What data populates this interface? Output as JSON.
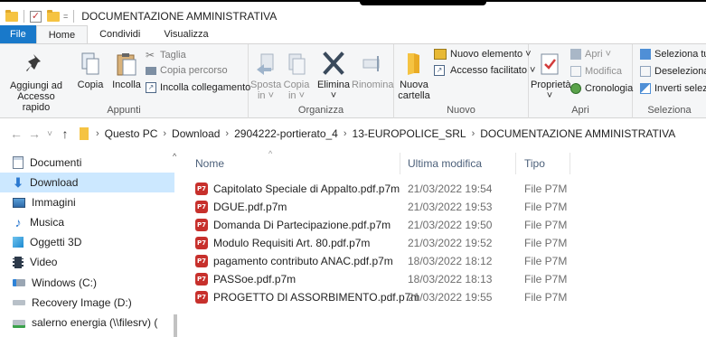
{
  "window": {
    "title": "DOCUMENTAZIONE AMMINISTRATIVA",
    "qat_dropdown": "="
  },
  "tabs": [
    {
      "label": "File"
    },
    {
      "label": "Home"
    },
    {
      "label": "Condividi"
    },
    {
      "label": "Visualizza"
    }
  ],
  "ribbon": {
    "appunti": {
      "label": "Appunti",
      "pin_line1": "Aggiungi ad",
      "pin_line2": "Accesso rapido",
      "copy": "Copia",
      "paste": "Incolla",
      "cut": "Taglia",
      "copy_path": "Copia percorso",
      "paste_link": "Incolla collegamento"
    },
    "organizza": {
      "label": "Organizza",
      "move_line1": "Sposta",
      "move_line2": "in ˅",
      "copyto_line1": "Copia",
      "copyto_line2": "in ˅",
      "delete": "Elimina",
      "delete_arrow": "˅",
      "rename": "Rinomina"
    },
    "nuovo": {
      "label": "Nuovo",
      "new_folder_line1": "Nuova",
      "new_folder_line2": "cartella",
      "new_item": "Nuovo elemento ˅",
      "easy_access": "Accesso facilitato ˅"
    },
    "apri": {
      "label": "Apri",
      "properties": "Proprietà",
      "properties_arrow": "˅",
      "open": "Apri ˅",
      "edit": "Modifica",
      "history": "Cronologia"
    },
    "seleziona": {
      "label": "Seleziona",
      "select_all": "Seleziona tutt",
      "deselect": "Deseleziona t",
      "invert": "Inverti selezio"
    }
  },
  "address": {
    "crumbs": [
      "Questo PC",
      "Download",
      "2904222-portierato_4",
      "13-EUROPOLICE_SRL",
      "DOCUMENTAZIONE AMMINISTRATIVA"
    ]
  },
  "nav_pane": [
    {
      "label": "Documenti",
      "icon": "documents-icon"
    },
    {
      "label": "Download",
      "icon": "download-icon"
    },
    {
      "label": "Immagini",
      "icon": "pictures-icon"
    },
    {
      "label": "Musica",
      "icon": "music-icon"
    },
    {
      "label": "Oggetti 3D",
      "icon": "objects3d-icon"
    },
    {
      "label": "Video",
      "icon": "video-icon"
    },
    {
      "label": "Windows (C:)",
      "icon": "drive-icon"
    },
    {
      "label": "Recovery Image (D:)",
      "icon": "drive-icon"
    },
    {
      "label": "salerno energia (\\\\filesrv) (",
      "icon": "network-drive-icon"
    }
  ],
  "columns": {
    "name": "Nome",
    "modified": "Ultima modifica",
    "type": "Tipo"
  },
  "files": [
    {
      "name": "Capitolato Speciale di Appalto.pdf.p7m",
      "modified": "21/03/2022 19:54",
      "type": "File P7M"
    },
    {
      "name": "DGUE.pdf.p7m",
      "modified": "21/03/2022 19:53",
      "type": "File P7M"
    },
    {
      "name": "Domanda Di Partecipazione.pdf.p7m",
      "modified": "21/03/2022 19:50",
      "type": "File P7M"
    },
    {
      "name": "Modulo Requisiti Art. 80.pdf.p7m",
      "modified": "21/03/2022 19:52",
      "type": "File P7M"
    },
    {
      "name": "pagamento contributo ANAC.pdf.p7m",
      "modified": "18/03/2022 18:12",
      "type": "File P7M"
    },
    {
      "name": "PASSoe.pdf.p7m",
      "modified": "18/03/2022 18:13",
      "type": "File P7M"
    },
    {
      "name": "PROGETTO DI ASSORBIMENTO.pdf.p7m",
      "modified": "21/03/2022 19:55",
      "type": "File P7M"
    }
  ],
  "colors": {
    "file_tab": "#1979ca",
    "selected_nav": "#cce8ff",
    "folder": "#f5c342",
    "p7m_icon": "#c7302c"
  }
}
